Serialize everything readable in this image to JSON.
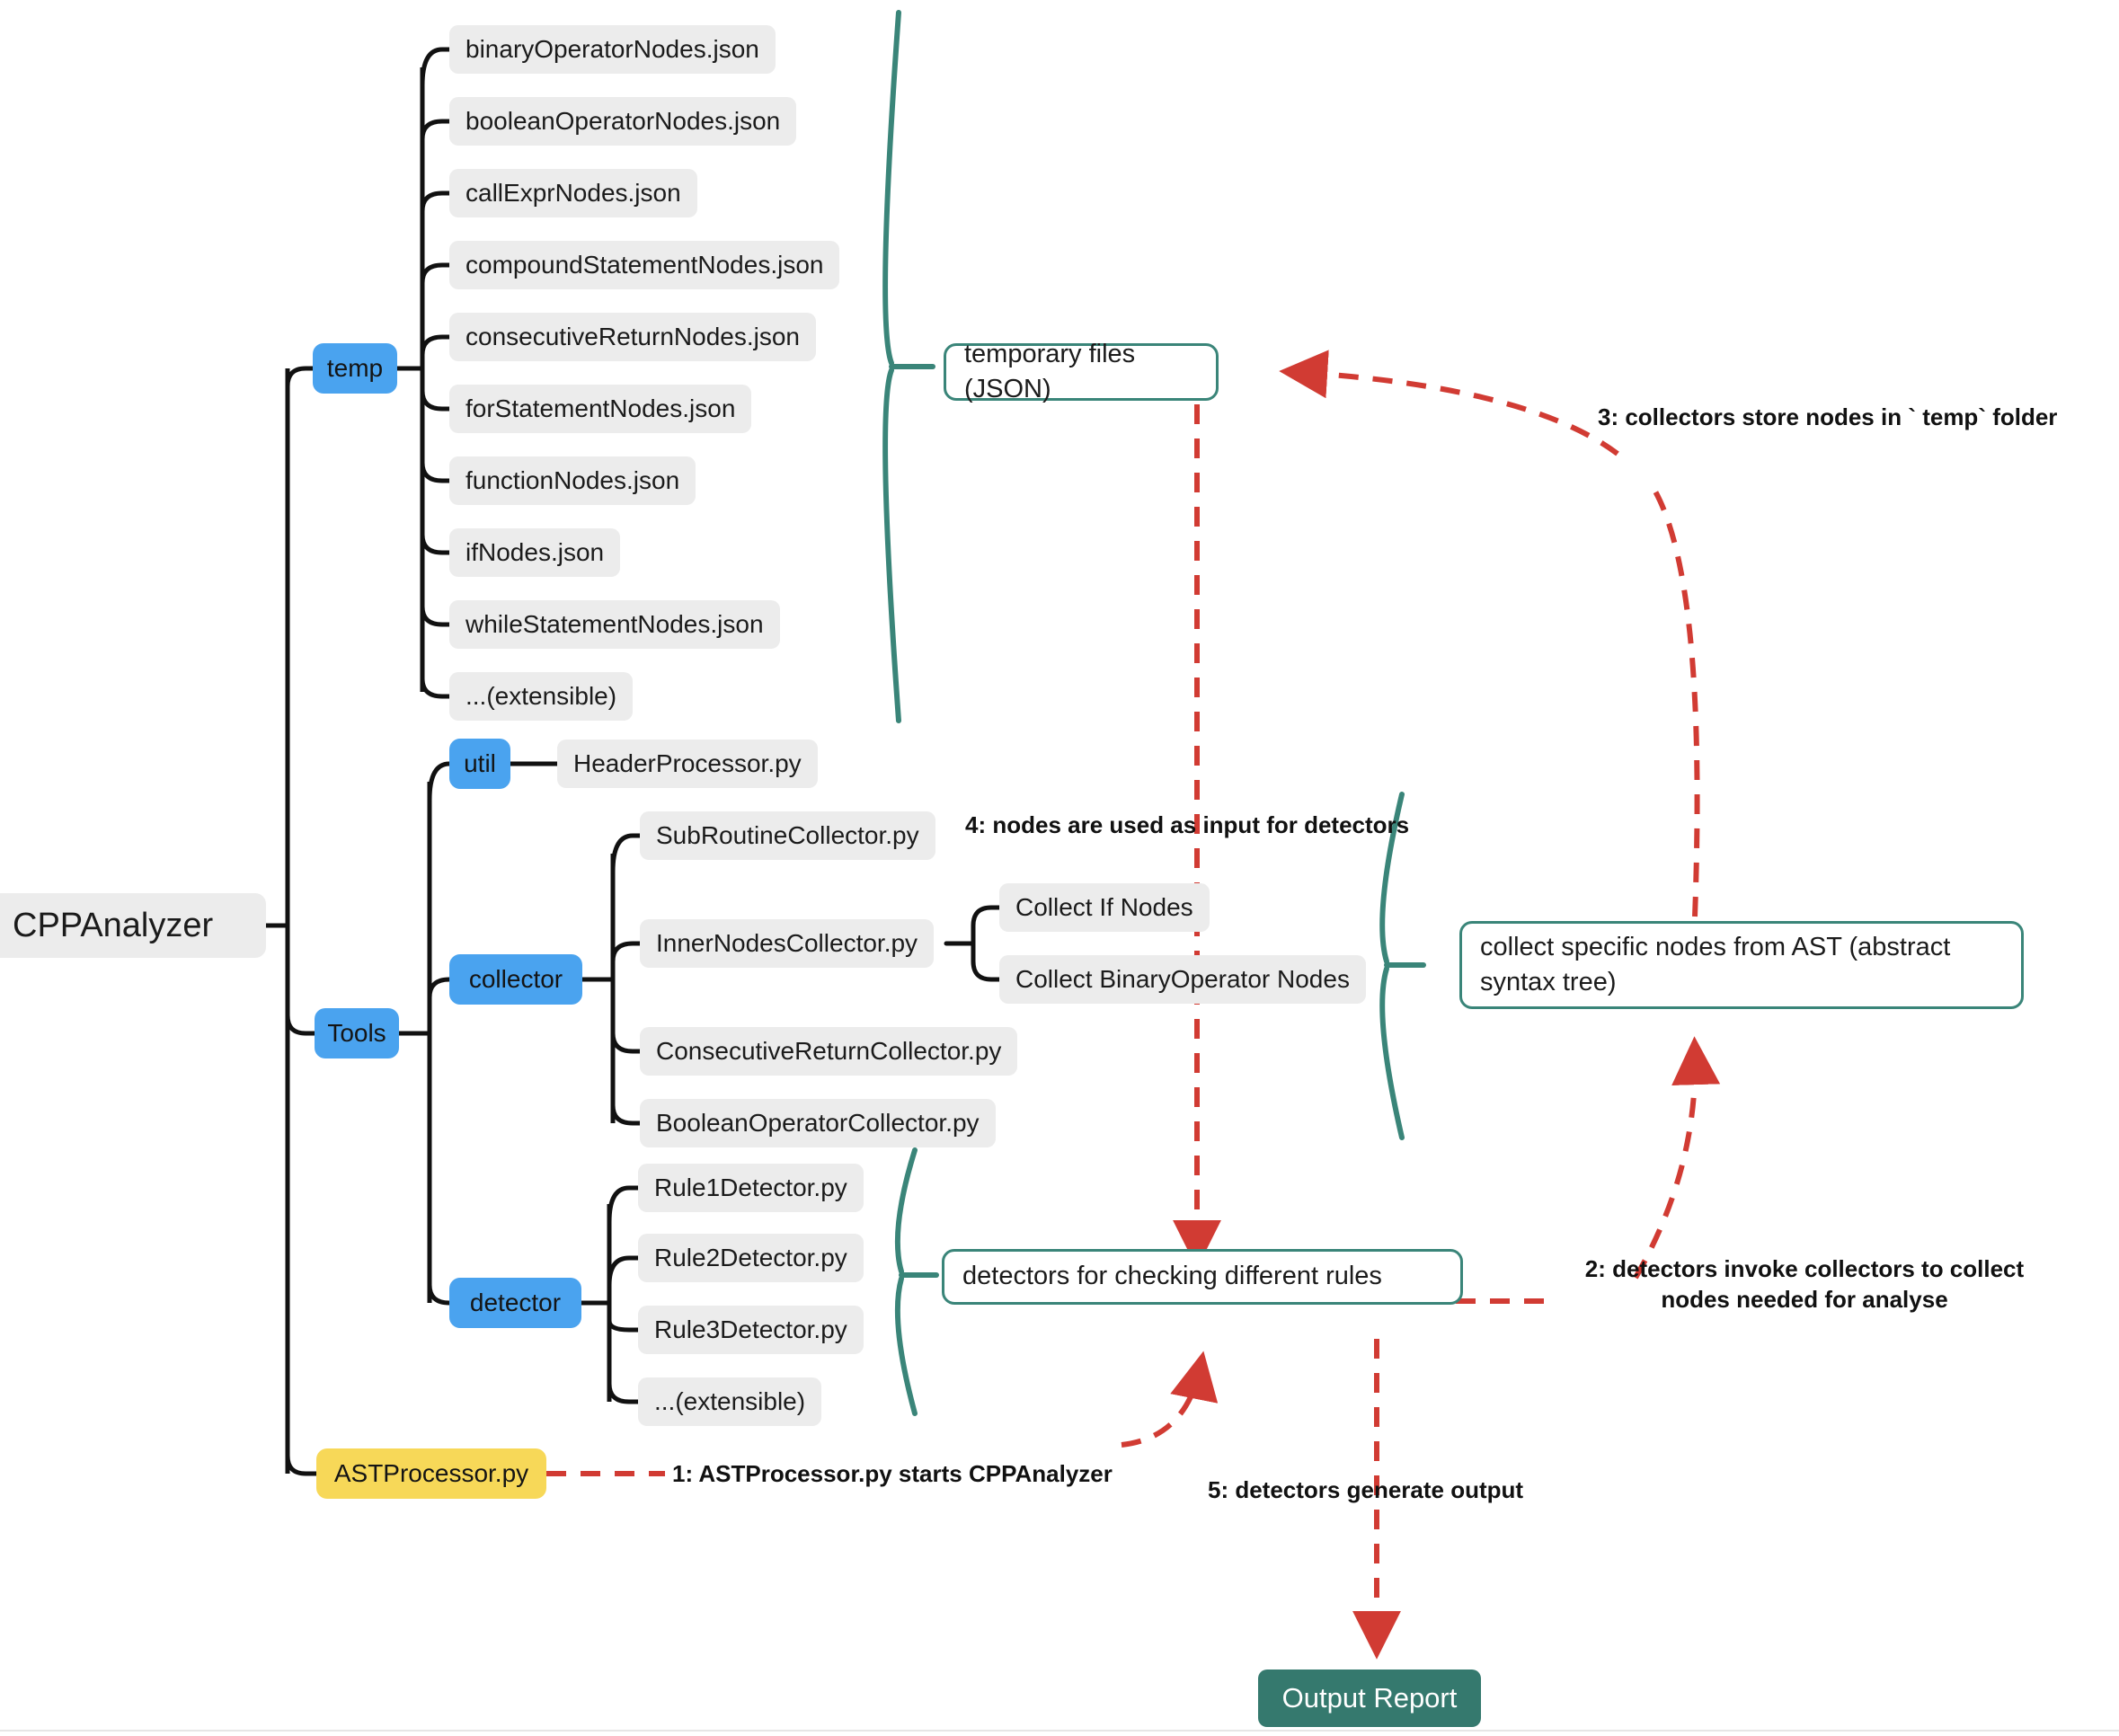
{
  "diagram": {
    "title": "CPPAnalyzer architecture mindmap",
    "root": {
      "label": "CPPAnalyzer"
    },
    "colors": {
      "branch_blue": "#4aa3ef",
      "entry_yellow": "#f7d858",
      "leaf_grey": "#ececec",
      "annotation_teal": "#3a8579",
      "output_teal": "#35796e",
      "flow_red": "#d13b33",
      "tree_line": "#111111"
    },
    "branches": [
      {
        "name": "temp",
        "label": "temp",
        "children": [
          {
            "label": "binaryOperatorNodes.json"
          },
          {
            "label": "booleanOperatorNodes.json"
          },
          {
            "label": "callExprNodes.json"
          },
          {
            "label": "compoundStatementNodes.json"
          },
          {
            "label": "consecutiveReturnNodes.json"
          },
          {
            "label": "forStatementNodes.json"
          },
          {
            "label": "functionNodes.json"
          },
          {
            "label": "ifNodes.json"
          },
          {
            "label": "whileStatementNodes.json"
          },
          {
            "label": "...(extensible)"
          }
        ]
      },
      {
        "name": "tools",
        "label": "Tools",
        "children": [
          {
            "name": "util",
            "label": "util",
            "children": [
              {
                "label": "HeaderProcessor.py"
              }
            ]
          },
          {
            "name": "collector",
            "label": "collector",
            "children": [
              {
                "label": "SubRoutineCollector.py"
              },
              {
                "label": "InnerNodesCollector.py",
                "children": [
                  {
                    "label": "Collect If Nodes"
                  },
                  {
                    "label": "Collect BinaryOperator Nodes"
                  }
                ]
              },
              {
                "label": "ConsecutiveReturnCollector.py"
              },
              {
                "label": "BooleanOperatorCollector.py"
              }
            ]
          },
          {
            "name": "detector",
            "label": "detector",
            "children": [
              {
                "label": "Rule1Detector.py"
              },
              {
                "label": "Rule2Detector.py"
              },
              {
                "label": "Rule3Detector.py"
              },
              {
                "label": "...(extensible)"
              }
            ]
          }
        ]
      },
      {
        "name": "astprocessor",
        "label": "ASTProcessor.py",
        "children": []
      }
    ],
    "annotations": [
      {
        "name": "temp-annotation",
        "label": "temporary files (JSON)"
      },
      {
        "name": "collector-annotation",
        "label": "collect specific nodes from AST (abstract syntax tree)"
      },
      {
        "name": "detector-annotation",
        "label": "detectors for checking different rules"
      }
    ],
    "output": {
      "label": "Output Report"
    },
    "flow_steps": [
      {
        "number": "1",
        "label": "1: ASTProcessor.py starts CPPAnalyzer"
      },
      {
        "number": "2",
        "line1": "2: detectors invoke collectors to collect",
        "line2": "nodes needed for analyse"
      },
      {
        "number": "3",
        "label": "3: collectors store nodes in ` temp` folder"
      },
      {
        "number": "4",
        "label": "4: nodes are used as input for detectors"
      },
      {
        "number": "5",
        "label": "5: detectors generate output"
      }
    ]
  }
}
